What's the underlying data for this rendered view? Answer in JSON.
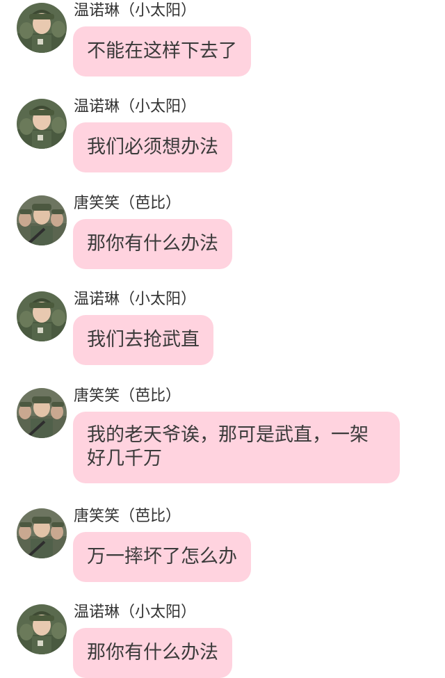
{
  "messages": [
    {
      "sender": "温诺琳（小太阳）",
      "text": "不能在这样下去了",
      "avatar": "avatar-female-soldier-icon"
    },
    {
      "sender": "温诺琳（小太阳）",
      "text": "我们必须想办法",
      "avatar": "avatar-female-soldier-icon"
    },
    {
      "sender": "唐笑笑（芭比）",
      "text": "那你有什么办法",
      "avatar": "avatar-soldier-group-icon"
    },
    {
      "sender": "温诺琳（小太阳）",
      "text": "我们去抢武直",
      "avatar": "avatar-female-soldier-icon"
    },
    {
      "sender": "唐笑笑（芭比）",
      "text": "我的老天爷诶，那可是武直，一架好几千万",
      "avatar": "avatar-soldier-group-icon"
    },
    {
      "sender": "唐笑笑（芭比）",
      "text": "万一摔坏了怎么办",
      "avatar": "avatar-soldier-group-icon"
    },
    {
      "sender": "温诺琳（小太阳）",
      "text": "那你有什么办法",
      "avatar": "avatar-female-soldier-icon"
    }
  ],
  "colors": {
    "bubble": "#ffd3df",
    "text": "#3a3a3a",
    "name": "#333333",
    "background": "#ffffff"
  }
}
